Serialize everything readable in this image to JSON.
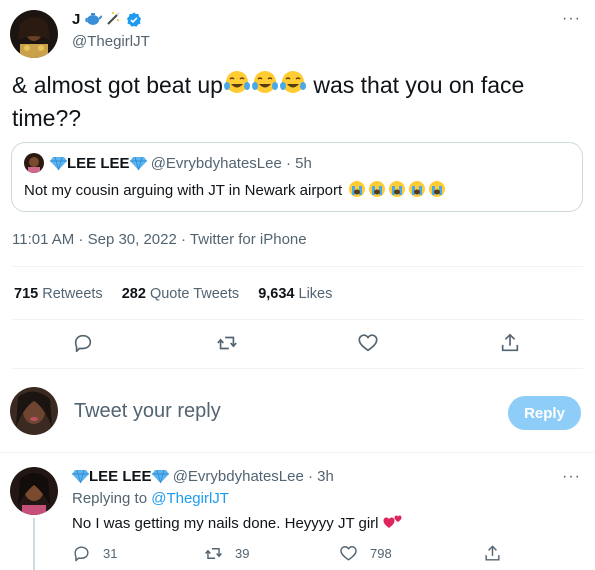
{
  "tweet": {
    "author_name": "J",
    "author_handle": "@ThegirlJT",
    "text_part1": "& almost got beat up",
    "text_part2": " was that you on face time??",
    "timestamp": "11:01 AM · Sep 30, 2022 · Twitter for iPhone",
    "more_label": "···"
  },
  "quote": {
    "name": "LEE LEE",
    "handle": "@EvrybdyhatesLee",
    "time": "· 5h",
    "text": "Not my cousin arguing with JT in Newark airport"
  },
  "stats": {
    "retweets_count": "715",
    "retweets_label": "Retweets",
    "quotes_count": "282",
    "quotes_label": "Quote Tweets",
    "likes_count": "9,634",
    "likes_label": "Likes"
  },
  "reply_box": {
    "placeholder": "Tweet your reply",
    "button_label": "Reply"
  },
  "reply": {
    "name": "LEE LEE",
    "handle": "@EvrybdyhatesLee",
    "time": "· 3h",
    "replying_prefix": "Replying to",
    "replying_to": "@ThegirlJT",
    "text": "No I was getting my nails done. Heyyyy JT girl",
    "reply_count": "31",
    "retweet_count": "39",
    "like_count": "798",
    "more_label": "···"
  },
  "icons": {
    "avatar": "avatar",
    "verified": "verified-badge-icon",
    "teapot": "teapot-icon",
    "wand": "magic-wand-icon",
    "diamond": "gem-icon",
    "laugh": "tears-of-joy-emoji",
    "sob": "loudly-crying-emoji",
    "heart_emoji": "two-hearts-emoji",
    "reply": "reply-icon",
    "retweet": "retweet-icon",
    "like": "heart-icon",
    "share": "share-icon"
  },
  "colors": {
    "accent": "#1d9bf0",
    "reply_button": "#8ecdf8",
    "secondary_text": "#536471",
    "divider": "#eff3f4"
  }
}
